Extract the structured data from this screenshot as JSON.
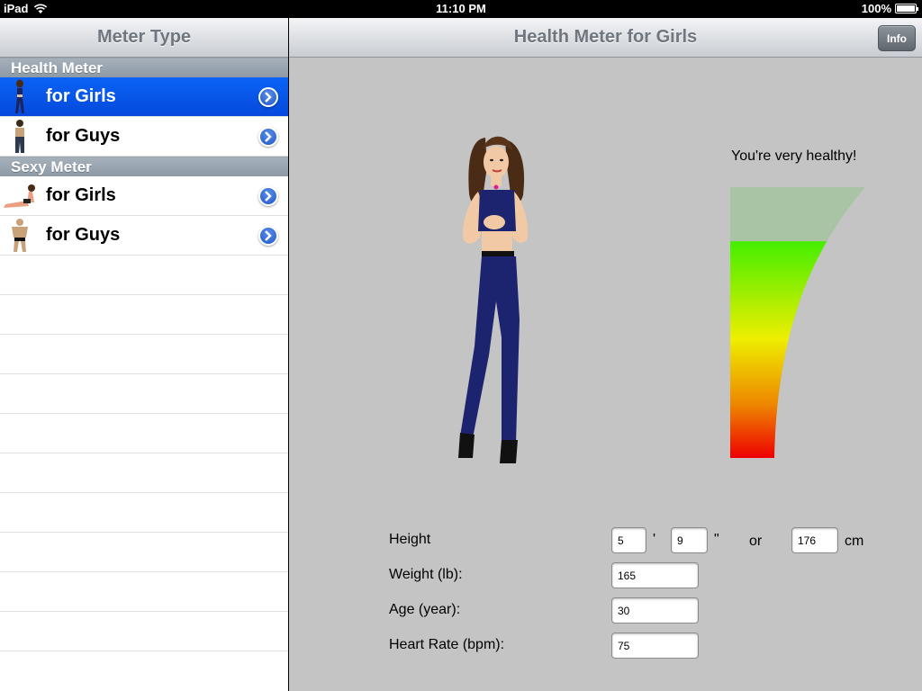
{
  "status": {
    "device": "iPad",
    "time": "11:10 PM",
    "battery": "100%"
  },
  "master": {
    "title": "Meter Type",
    "sections": [
      {
        "header": "Health Meter",
        "items": [
          {
            "label": "for Girls",
            "selected": true
          },
          {
            "label": "for Guys",
            "selected": false
          }
        ]
      },
      {
        "header": "Sexy Meter",
        "items": [
          {
            "label": "for Girls",
            "selected": false
          },
          {
            "label": "for Guys",
            "selected": false
          }
        ]
      }
    ]
  },
  "detail": {
    "title": "Health Meter for Girls",
    "info_label": "Info",
    "verdict": "You're very healthy!",
    "meter_level": 0.8,
    "form": {
      "height_label": "Height",
      "height_feet": "5",
      "feet_unit": "'",
      "height_inches": "9",
      "inches_unit": "\"",
      "or_label": "or",
      "height_cm": "176",
      "cm_unit": "cm",
      "weight_label": "Weight (lb):",
      "weight": "165",
      "age_label": "Age (year):",
      "age": "30",
      "heart_label": "Heart Rate (bpm):",
      "heart": "75"
    }
  },
  "colors": {
    "selected": "#0a63f5",
    "background": "#c4c4c4",
    "meter_top": "#44ee00",
    "meter_bottom": "#ee0000"
  }
}
